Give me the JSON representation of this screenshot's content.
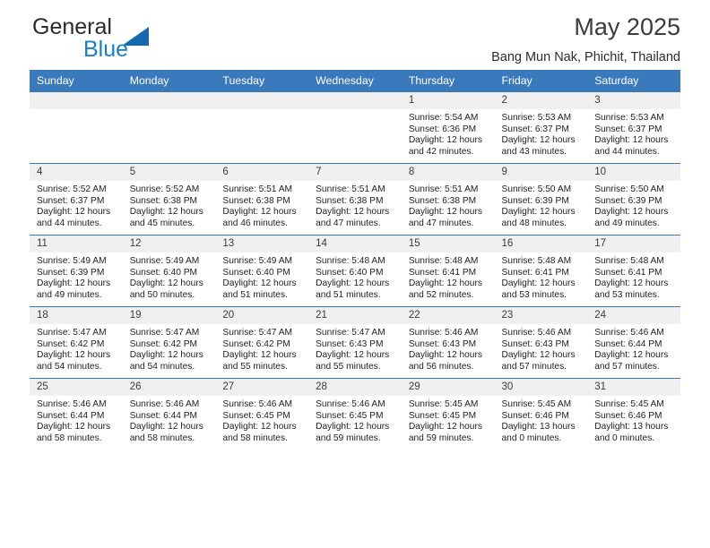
{
  "brand": {
    "word_one": "General",
    "word_two": "Blue",
    "triangle_color": "#1669b0",
    "blue_text_color": "#1481c8"
  },
  "header": {
    "title": "May 2025",
    "subtitle": "Bang Mun Nak, Phichit, Thailand",
    "header_bg_color": "#3b79bd"
  },
  "weekdays": [
    "Sunday",
    "Monday",
    "Tuesday",
    "Wednesday",
    "Thursday",
    "Friday",
    "Saturday"
  ],
  "weeks": [
    [
      {
        "day": "",
        "lines": []
      },
      {
        "day": "",
        "lines": []
      },
      {
        "day": "",
        "lines": []
      },
      {
        "day": "",
        "lines": []
      },
      {
        "day": "1",
        "lines": [
          "Sunrise: 5:54 AM",
          "Sunset: 6:36 PM",
          "Daylight: 12 hours",
          "and 42 minutes."
        ]
      },
      {
        "day": "2",
        "lines": [
          "Sunrise: 5:53 AM",
          "Sunset: 6:37 PM",
          "Daylight: 12 hours",
          "and 43 minutes."
        ]
      },
      {
        "day": "3",
        "lines": [
          "Sunrise: 5:53 AM",
          "Sunset: 6:37 PM",
          "Daylight: 12 hours",
          "and 44 minutes."
        ]
      }
    ],
    [
      {
        "day": "4",
        "lines": [
          "Sunrise: 5:52 AM",
          "Sunset: 6:37 PM",
          "Daylight: 12 hours",
          "and 44 minutes."
        ]
      },
      {
        "day": "5",
        "lines": [
          "Sunrise: 5:52 AM",
          "Sunset: 6:38 PM",
          "Daylight: 12 hours",
          "and 45 minutes."
        ]
      },
      {
        "day": "6",
        "lines": [
          "Sunrise: 5:51 AM",
          "Sunset: 6:38 PM",
          "Daylight: 12 hours",
          "and 46 minutes."
        ]
      },
      {
        "day": "7",
        "lines": [
          "Sunrise: 5:51 AM",
          "Sunset: 6:38 PM",
          "Daylight: 12 hours",
          "and 47 minutes."
        ]
      },
      {
        "day": "8",
        "lines": [
          "Sunrise: 5:51 AM",
          "Sunset: 6:38 PM",
          "Daylight: 12 hours",
          "and 47 minutes."
        ]
      },
      {
        "day": "9",
        "lines": [
          "Sunrise: 5:50 AM",
          "Sunset: 6:39 PM",
          "Daylight: 12 hours",
          "and 48 minutes."
        ]
      },
      {
        "day": "10",
        "lines": [
          "Sunrise: 5:50 AM",
          "Sunset: 6:39 PM",
          "Daylight: 12 hours",
          "and 49 minutes."
        ]
      }
    ],
    [
      {
        "day": "11",
        "lines": [
          "Sunrise: 5:49 AM",
          "Sunset: 6:39 PM",
          "Daylight: 12 hours",
          "and 49 minutes."
        ]
      },
      {
        "day": "12",
        "lines": [
          "Sunrise: 5:49 AM",
          "Sunset: 6:40 PM",
          "Daylight: 12 hours",
          "and 50 minutes."
        ]
      },
      {
        "day": "13",
        "lines": [
          "Sunrise: 5:49 AM",
          "Sunset: 6:40 PM",
          "Daylight: 12 hours",
          "and 51 minutes."
        ]
      },
      {
        "day": "14",
        "lines": [
          "Sunrise: 5:48 AM",
          "Sunset: 6:40 PM",
          "Daylight: 12 hours",
          "and 51 minutes."
        ]
      },
      {
        "day": "15",
        "lines": [
          "Sunrise: 5:48 AM",
          "Sunset: 6:41 PM",
          "Daylight: 12 hours",
          "and 52 minutes."
        ]
      },
      {
        "day": "16",
        "lines": [
          "Sunrise: 5:48 AM",
          "Sunset: 6:41 PM",
          "Daylight: 12 hours",
          "and 53 minutes."
        ]
      },
      {
        "day": "17",
        "lines": [
          "Sunrise: 5:48 AM",
          "Sunset: 6:41 PM",
          "Daylight: 12 hours",
          "and 53 minutes."
        ]
      }
    ],
    [
      {
        "day": "18",
        "lines": [
          "Sunrise: 5:47 AM",
          "Sunset: 6:42 PM",
          "Daylight: 12 hours",
          "and 54 minutes."
        ]
      },
      {
        "day": "19",
        "lines": [
          "Sunrise: 5:47 AM",
          "Sunset: 6:42 PM",
          "Daylight: 12 hours",
          "and 54 minutes."
        ]
      },
      {
        "day": "20",
        "lines": [
          "Sunrise: 5:47 AM",
          "Sunset: 6:42 PM",
          "Daylight: 12 hours",
          "and 55 minutes."
        ]
      },
      {
        "day": "21",
        "lines": [
          "Sunrise: 5:47 AM",
          "Sunset: 6:43 PM",
          "Daylight: 12 hours",
          "and 55 minutes."
        ]
      },
      {
        "day": "22",
        "lines": [
          "Sunrise: 5:46 AM",
          "Sunset: 6:43 PM",
          "Daylight: 12 hours",
          "and 56 minutes."
        ]
      },
      {
        "day": "23",
        "lines": [
          "Sunrise: 5:46 AM",
          "Sunset: 6:43 PM",
          "Daylight: 12 hours",
          "and 57 minutes."
        ]
      },
      {
        "day": "24",
        "lines": [
          "Sunrise: 5:46 AM",
          "Sunset: 6:44 PM",
          "Daylight: 12 hours",
          "and 57 minutes."
        ]
      }
    ],
    [
      {
        "day": "25",
        "lines": [
          "Sunrise: 5:46 AM",
          "Sunset: 6:44 PM",
          "Daylight: 12 hours",
          "and 58 minutes."
        ]
      },
      {
        "day": "26",
        "lines": [
          "Sunrise: 5:46 AM",
          "Sunset: 6:44 PM",
          "Daylight: 12 hours",
          "and 58 minutes."
        ]
      },
      {
        "day": "27",
        "lines": [
          "Sunrise: 5:46 AM",
          "Sunset: 6:45 PM",
          "Daylight: 12 hours",
          "and 58 minutes."
        ]
      },
      {
        "day": "28",
        "lines": [
          "Sunrise: 5:46 AM",
          "Sunset: 6:45 PM",
          "Daylight: 12 hours",
          "and 59 minutes."
        ]
      },
      {
        "day": "29",
        "lines": [
          "Sunrise: 5:45 AM",
          "Sunset: 6:45 PM",
          "Daylight: 12 hours",
          "and 59 minutes."
        ]
      },
      {
        "day": "30",
        "lines": [
          "Sunrise: 5:45 AM",
          "Sunset: 6:46 PM",
          "Daylight: 13 hours",
          "and 0 minutes."
        ]
      },
      {
        "day": "31",
        "lines": [
          "Sunrise: 5:45 AM",
          "Sunset: 6:46 PM",
          "Daylight: 13 hours",
          "and 0 minutes."
        ]
      }
    ]
  ]
}
